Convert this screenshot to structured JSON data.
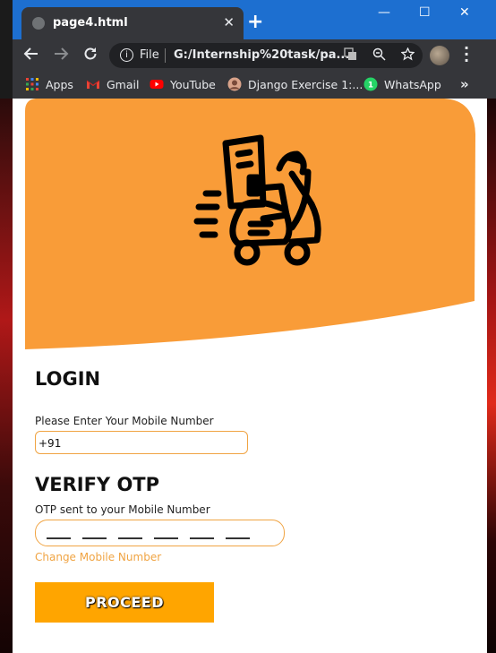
{
  "browser": {
    "tab_title": "page4.html",
    "tab_close": "✕",
    "new_tab": "+",
    "window_controls": {
      "minimize": "—",
      "maximize": "☐",
      "close": "✕"
    },
    "address_scheme": "File",
    "address_url": "G:/Internship%20task/pa...",
    "bookmarks": [
      {
        "label": "Apps",
        "icon": "apps-grid-icon"
      },
      {
        "label": "Gmail",
        "icon": "gmail-icon"
      },
      {
        "label": "YouTube",
        "icon": "youtube-icon"
      },
      {
        "label": "Django Exercise 1:...",
        "icon": "profile-icon"
      },
      {
        "label": "WhatsApp",
        "icon": "whatsapp-icon"
      }
    ],
    "bookmarks_overflow": "»"
  },
  "colors": {
    "accent": "#F99C38",
    "input_border": "#F0A443",
    "button": "#FFA500",
    "title_bar": "#1D6FD0"
  },
  "login": {
    "heading": "LOGIN",
    "mobile_label": "Please Enter Your Mobile Number",
    "mobile_value": "+91"
  },
  "verify": {
    "heading": "VERIFY OTP",
    "otp_label": "OTP sent to your Mobile Number",
    "otp_slots": 6,
    "change_link": "Change Mobile Number"
  },
  "proceed_button": "PROCEED"
}
